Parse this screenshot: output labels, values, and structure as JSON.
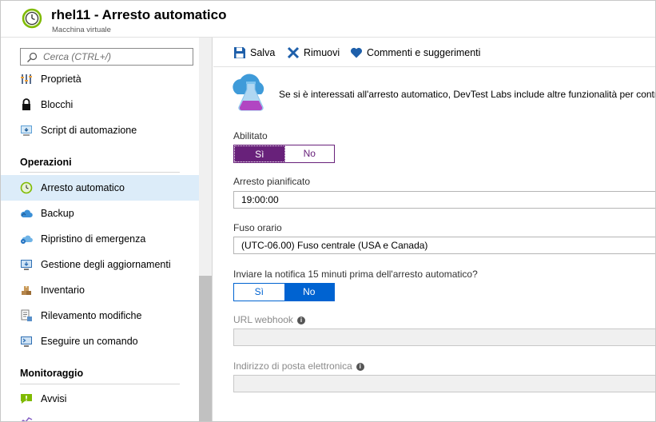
{
  "header": {
    "title": "rhel11 - Arresto automatico",
    "subtitle": "Macchina virtuale",
    "icon": "clock-icon"
  },
  "sidebar": {
    "search_placeholder": "Cerca (CTRL+/)",
    "collapse_glyph": "«",
    "items_top": [
      {
        "label": "Proprietà",
        "icon": "properties-icon"
      },
      {
        "label": "Blocchi",
        "icon": "lock-icon"
      },
      {
        "label": "Script di automazione",
        "icon": "automation-script-icon"
      }
    ],
    "sections": [
      {
        "heading": "Operazioni",
        "items": [
          {
            "label": "Arresto automatico",
            "icon": "clock-icon",
            "active": true
          },
          {
            "label": "Backup",
            "icon": "cloud-backup-icon"
          },
          {
            "label": "Ripristino di emergenza",
            "icon": "cloud-recovery-icon"
          },
          {
            "label": "Gestione degli aggiornamenti",
            "icon": "update-management-icon"
          },
          {
            "label": "Inventario",
            "icon": "inventory-icon"
          },
          {
            "label": "Rilevamento modifiche",
            "icon": "change-tracking-icon"
          },
          {
            "label": "Eseguire un comando",
            "icon": "run-command-icon"
          }
        ]
      },
      {
        "heading": "Monitoraggio",
        "items": [
          {
            "label": "Avvisi",
            "icon": "alert-icon"
          }
        ]
      }
    ]
  },
  "toolbar": {
    "save_label": "Salva",
    "discard_label": "Rimuovi",
    "feedback_label": "Commenti e suggerimenti"
  },
  "banner": {
    "text": "Se si è interessati all'arresto automatico, DevTest Labs include altre funzionalità per contr"
  },
  "form": {
    "enabled": {
      "label": "Abilitato",
      "yes": "Sì",
      "no": "No",
      "selected": "Sì"
    },
    "scheduled_shutdown": {
      "label": "Arresto pianificato",
      "value": "19:00:00"
    },
    "time_zone": {
      "label": "Fuso orario",
      "value": "(UTC-06.00) Fuso centrale (USA e Canada)"
    },
    "notify": {
      "label": "Inviare la notifica 15 minuti prima dell'arresto automatico?",
      "yes": "Sì",
      "no": "No",
      "selected": "No"
    },
    "webhook": {
      "label": "URL webhook",
      "value": ""
    },
    "email": {
      "label": "Indirizzo di posta elettronica",
      "value": ""
    }
  },
  "colors": {
    "accent_purple": "#68217a",
    "accent_blue": "#0063d1",
    "active_nav_bg": "#dcecf9"
  }
}
